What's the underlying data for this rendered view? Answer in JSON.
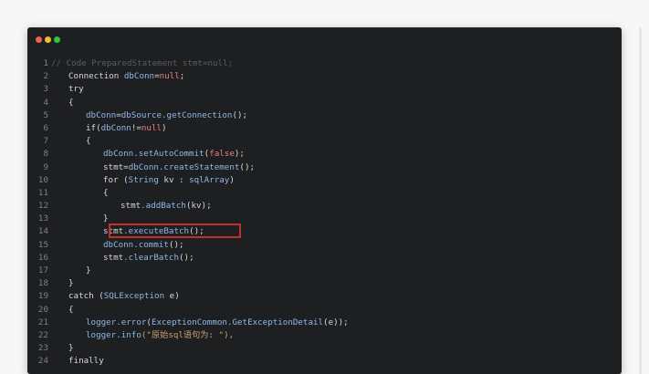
{
  "window": {
    "controls": {
      "close": "close",
      "minimize": "minimize",
      "maximize": "maximize"
    }
  },
  "code": {
    "lines": [
      {
        "num": "1",
        "indent": 0,
        "tokens": [
          {
            "t": "// Code PreparedStatement stmt=null;",
            "c": "cm"
          }
        ]
      },
      {
        "num": "2",
        "indent": 1,
        "tokens": [
          {
            "t": "Connection ",
            "c": "kw"
          },
          {
            "t": "dbConn",
            "c": "cls"
          },
          {
            "t": "=",
            "c": "kw"
          },
          {
            "t": "null",
            "c": "num"
          },
          {
            "t": ";",
            "c": "kw"
          }
        ]
      },
      {
        "num": "3",
        "indent": 1,
        "tokens": [
          {
            "t": "try",
            "c": "kw"
          }
        ]
      },
      {
        "num": "4",
        "indent": 1,
        "tokens": [
          {
            "t": "{",
            "c": "kw"
          }
        ]
      },
      {
        "num": "5",
        "indent": 2,
        "tokens": [
          {
            "t": "dbConn",
            "c": "cls"
          },
          {
            "t": "=",
            "c": "kw"
          },
          {
            "t": "dbSource",
            "c": "cls"
          },
          {
            "t": ".getConnection",
            "c": "cls"
          },
          {
            "t": "();",
            "c": "kw"
          }
        ]
      },
      {
        "num": "6",
        "indent": 2,
        "tokens": [
          {
            "t": "if(",
            "c": "kw"
          },
          {
            "t": "dbConn",
            "c": "cls"
          },
          {
            "t": "!=",
            "c": "kw"
          },
          {
            "t": "null",
            "c": "num"
          },
          {
            "t": ")",
            "c": "kw"
          }
        ]
      },
      {
        "num": "7",
        "indent": 2,
        "tokens": [
          {
            "t": "{",
            "c": "kw"
          }
        ]
      },
      {
        "num": "8",
        "indent": 3,
        "tokens": [
          {
            "t": "dbConn",
            "c": "cls"
          },
          {
            "t": ".setAutoCommit",
            "c": "cls"
          },
          {
            "t": "(",
            "c": "kw"
          },
          {
            "t": "false",
            "c": "num"
          },
          {
            "t": ");",
            "c": "kw"
          }
        ]
      },
      {
        "num": "9",
        "indent": 3,
        "tokens": [
          {
            "t": "stmt",
            "c": "kw"
          },
          {
            "t": "=",
            "c": "kw"
          },
          {
            "t": "dbConn",
            "c": "cls"
          },
          {
            "t": ".createStatement",
            "c": "cls"
          },
          {
            "t": "();",
            "c": "kw"
          }
        ]
      },
      {
        "num": "10",
        "indent": 3,
        "tokens": [
          {
            "t": "for (",
            "c": "kw"
          },
          {
            "t": "String",
            "c": "cls"
          },
          {
            "t": " kv : ",
            "c": "kw"
          },
          {
            "t": "sqlArray",
            "c": "cls"
          },
          {
            "t": ")",
            "c": "kw"
          }
        ]
      },
      {
        "num": "11",
        "indent": 3,
        "tokens": [
          {
            "t": "{",
            "c": "kw"
          }
        ]
      },
      {
        "num": "12",
        "indent": 4,
        "tokens": [
          {
            "t": "stmt",
            "c": "kw"
          },
          {
            "t": ".addBatch",
            "c": "cls"
          },
          {
            "t": "(kv);",
            "c": "kw"
          }
        ]
      },
      {
        "num": "13",
        "indent": 3,
        "tokens": [
          {
            "t": "}",
            "c": "kw"
          }
        ]
      },
      {
        "num": "14",
        "indent": 3,
        "tokens": [
          {
            "t": "stmt",
            "c": "kw"
          },
          {
            "t": ".executeBatch",
            "c": "cls"
          },
          {
            "t": "();",
            "c": "kw"
          }
        ]
      },
      {
        "num": "15",
        "indent": 3,
        "tokens": [
          {
            "t": "dbConn",
            "c": "cls"
          },
          {
            "t": ".commit",
            "c": "cls"
          },
          {
            "t": "();",
            "c": "kw"
          }
        ]
      },
      {
        "num": "16",
        "indent": 3,
        "tokens": [
          {
            "t": "stmt",
            "c": "kw"
          },
          {
            "t": ".clearBatch",
            "c": "cls"
          },
          {
            "t": "();",
            "c": "kw"
          }
        ]
      },
      {
        "num": "17",
        "indent": 2,
        "tokens": [
          {
            "t": "}",
            "c": "kw"
          }
        ]
      },
      {
        "num": "18",
        "indent": 1,
        "tokens": [
          {
            "t": "}",
            "c": "kw"
          }
        ]
      },
      {
        "num": "19",
        "indent": 1,
        "tokens": [
          {
            "t": "catch (",
            "c": "kw"
          },
          {
            "t": "SQLException",
            "c": "cls"
          },
          {
            "t": " e)",
            "c": "kw"
          }
        ]
      },
      {
        "num": "20",
        "indent": 1,
        "tokens": [
          {
            "t": "{",
            "c": "kw"
          }
        ]
      },
      {
        "num": "21",
        "indent": 2,
        "tokens": [
          {
            "t": "logger",
            "c": "cls"
          },
          {
            "t": ".error",
            "c": "cls"
          },
          {
            "t": "(",
            "c": "kw"
          },
          {
            "t": "ExceptionCommon",
            "c": "cls"
          },
          {
            "t": ".GetExceptionDetail",
            "c": "cls"
          },
          {
            "t": "(e));",
            "c": "kw"
          }
        ]
      },
      {
        "num": "22",
        "indent": 2,
        "tokens": [
          {
            "t": "logger",
            "c": "cls"
          },
          {
            "t": ".info",
            "c": "cls"
          },
          {
            "t": "(\"原始sql语句为: \"),",
            "c": "str"
          }
        ]
      },
      {
        "num": "23",
        "indent": 1,
        "tokens": [
          {
            "t": "}",
            "c": "kw"
          }
        ]
      },
      {
        "num": "24",
        "indent": 1,
        "tokens": [
          {
            "t": "finally",
            "c": "kw"
          }
        ]
      }
    ]
  },
  "highlight": {
    "line": "14",
    "color": "#c22f2f"
  }
}
